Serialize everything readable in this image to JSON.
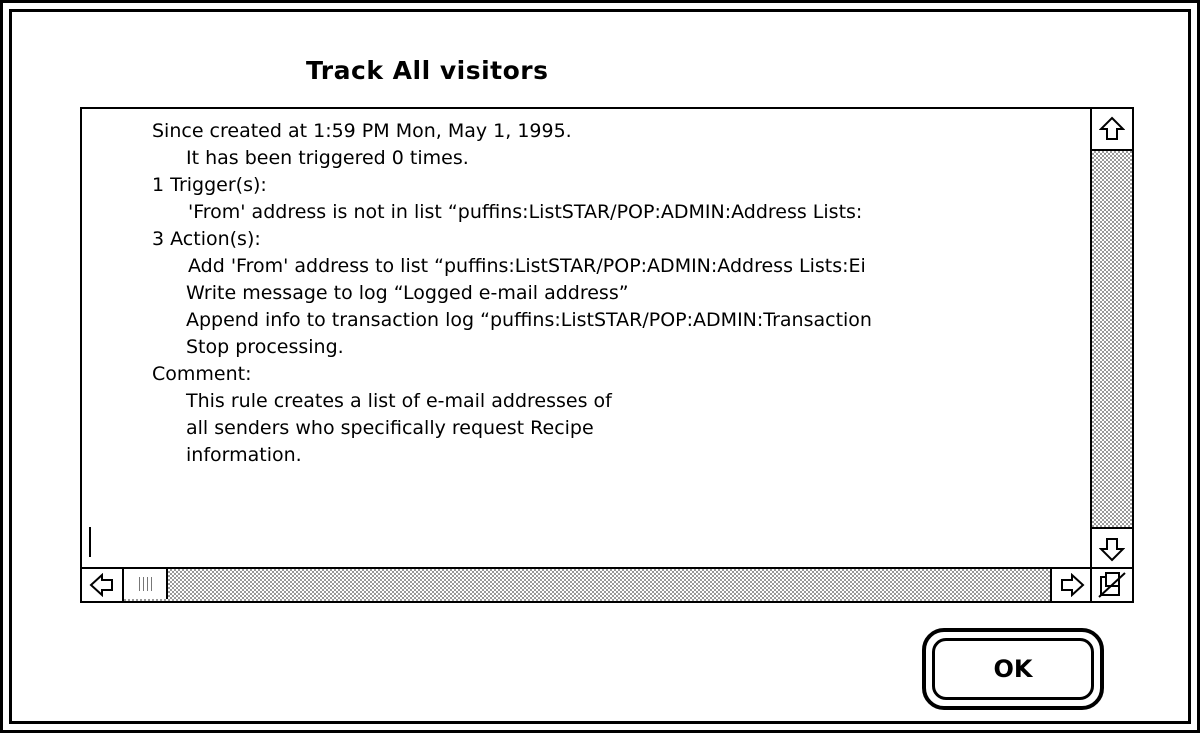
{
  "dialog": {
    "title": "Track All visitors",
    "ok_label": "OK"
  },
  "text_lines": [
    "Since created at 1:59 PM Mon, May 1, 1995.",
    "It has been triggered 0 times.",
    "1 Trigger(s):",
    "'From' address is not in list “puffins:ListSTAR/POP:ADMIN:Address Lists:",
    "3 Action(s):",
    "Add 'From' address to list “puffins:ListSTAR/POP:ADMIN:Address Lists:Ei",
    "Write message to log “Logged e-mail address”",
    "Append info to transaction log “puffins:ListSTAR/POP:ADMIN:Transaction",
    "Stop processing.",
    "Comment:",
    "This rule creates a list of e-mail addresses of",
    "all  senders who specifically request Recipe",
    "information."
  ],
  "icons": {
    "scroll_up": "up-arrow-icon",
    "scroll_down": "down-arrow-icon",
    "scroll_left": "left-arrow-icon",
    "scroll_right": "right-arrow-icon",
    "size_box": "no-resize-icon"
  },
  "colors": {
    "foreground": "#000000",
    "background": "#ffffff",
    "scroll_track": "#9a9a9a"
  }
}
